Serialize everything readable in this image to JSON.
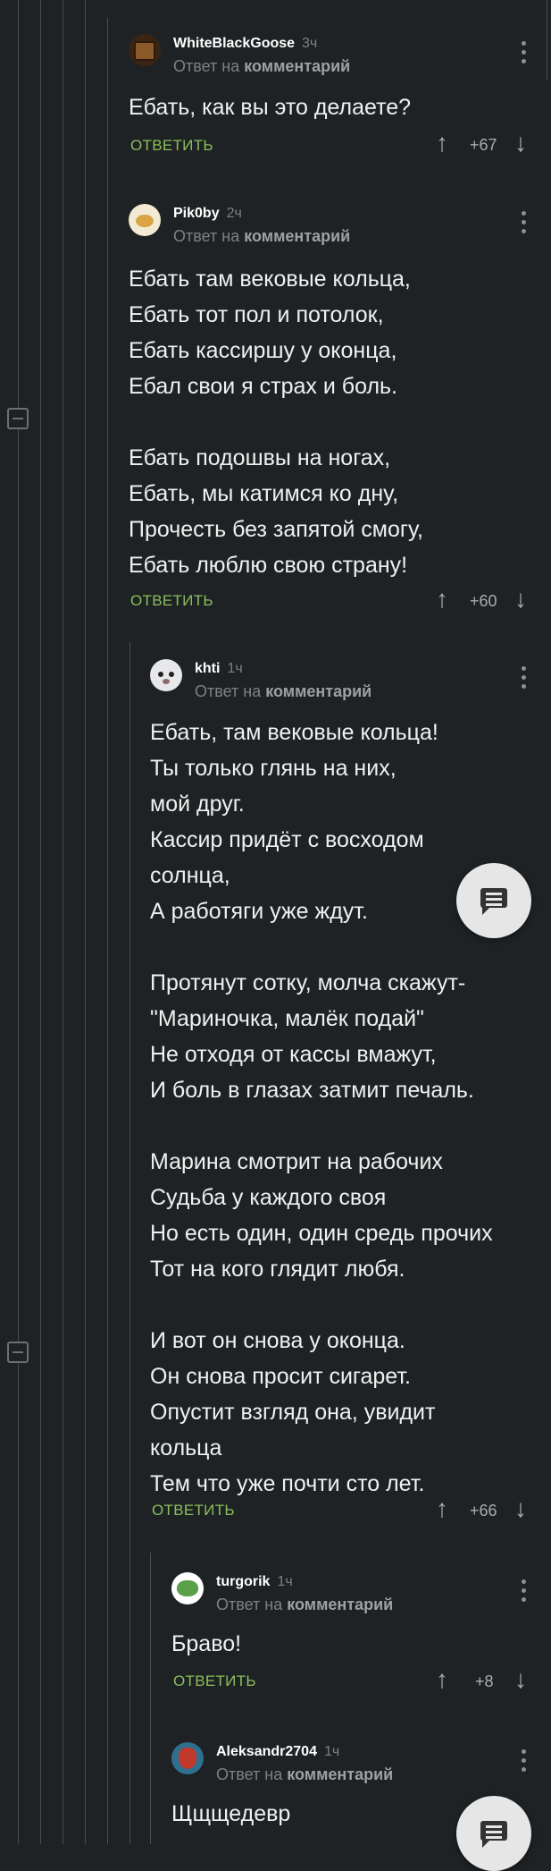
{
  "comments": [
    {
      "author": "WhiteBlackGoose",
      "time": "3ч",
      "reply_prefix": "Ответ на",
      "reply_target": "комментарий",
      "text": "Ебать, как вы это делаете?",
      "reply_label": "ОТВЕТИТЬ",
      "votes": "+67"
    },
    {
      "author": "Pik0by",
      "time": "2ч",
      "reply_prefix": "Ответ на",
      "reply_target": "комментарий",
      "text": "Ебать там вековые кольца,\nЕбать тот пол и потолок,\nЕбать кассиршу у оконца,\nЕбал свои я страх и боль.\n\nЕбать подошвы на ногах,\nЕбать, мы катимся ко дну,\nПрочесть без запятой смогу,\nЕбать люблю свою страну!",
      "reply_label": "ОТВЕТИТЬ",
      "votes": "+60"
    },
    {
      "author": "khti",
      "time": "1ч",
      "reply_prefix": "Ответ на",
      "reply_target": "комментарий",
      "text": "Ебать, там вековые кольца!\nТы только глянь на них,\nмой друг.\nКассир придёт с восходом\nсолнца,\nА работяги уже ждут.\n\nПротянут сотку, молча скажут-\n\"Мариночка, малёк подай\"\nНе отходя от кассы вмажут,\nИ боль в глазах затмит печаль.\n\nМарина смотрит на рабочих\nСудьба у каждого своя\nНо есть один, один средь прочих\nТот на кого глядит любя.\n\nИ вот он снова у оконца.\nОн снова просит сигарет.\nОпустит взгляд она, увидит\nкольца\nТем что уже почти сто лет.",
      "reply_label": "ОТВЕТИТЬ",
      "votes": "+66"
    },
    {
      "author": "turgorik",
      "time": "1ч",
      "reply_prefix": "Ответ на",
      "reply_target": "комментарий",
      "text": "Браво!",
      "reply_label": "ОТВЕТИТЬ",
      "votes": "+8"
    },
    {
      "author": "Aleksandr2704",
      "time": "1ч",
      "reply_prefix": "Ответ на",
      "reply_target": "комментарий",
      "text": "Щщщедевр"
    }
  ],
  "icons": {
    "upvote": "↑",
    "downvote": "↓",
    "fab": "comment-icon"
  }
}
